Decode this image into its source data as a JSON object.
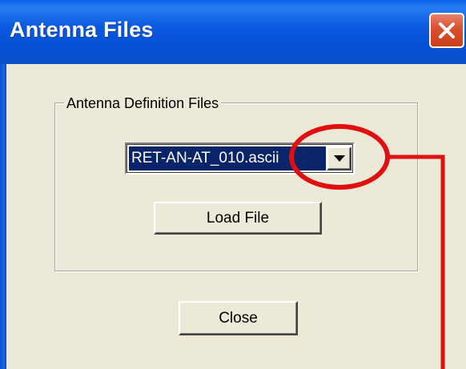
{
  "window": {
    "title": "Antenna Files"
  },
  "group": {
    "label": "Antenna Definition Files"
  },
  "combo": {
    "selected_value": "RET-AN-AT_010.ascii"
  },
  "buttons": {
    "load_label": "Load File",
    "close_label": "Close"
  },
  "colors": {
    "titlebar": "#0a56dc",
    "dialog_bg": "#ece9d8",
    "selection_bg": "#0a246a",
    "annotation": "#e01010",
    "close_button": "#d8502e"
  },
  "annotation": {
    "shape": "circle-with-callout-line",
    "target": "combo-dropdown-arrow"
  }
}
